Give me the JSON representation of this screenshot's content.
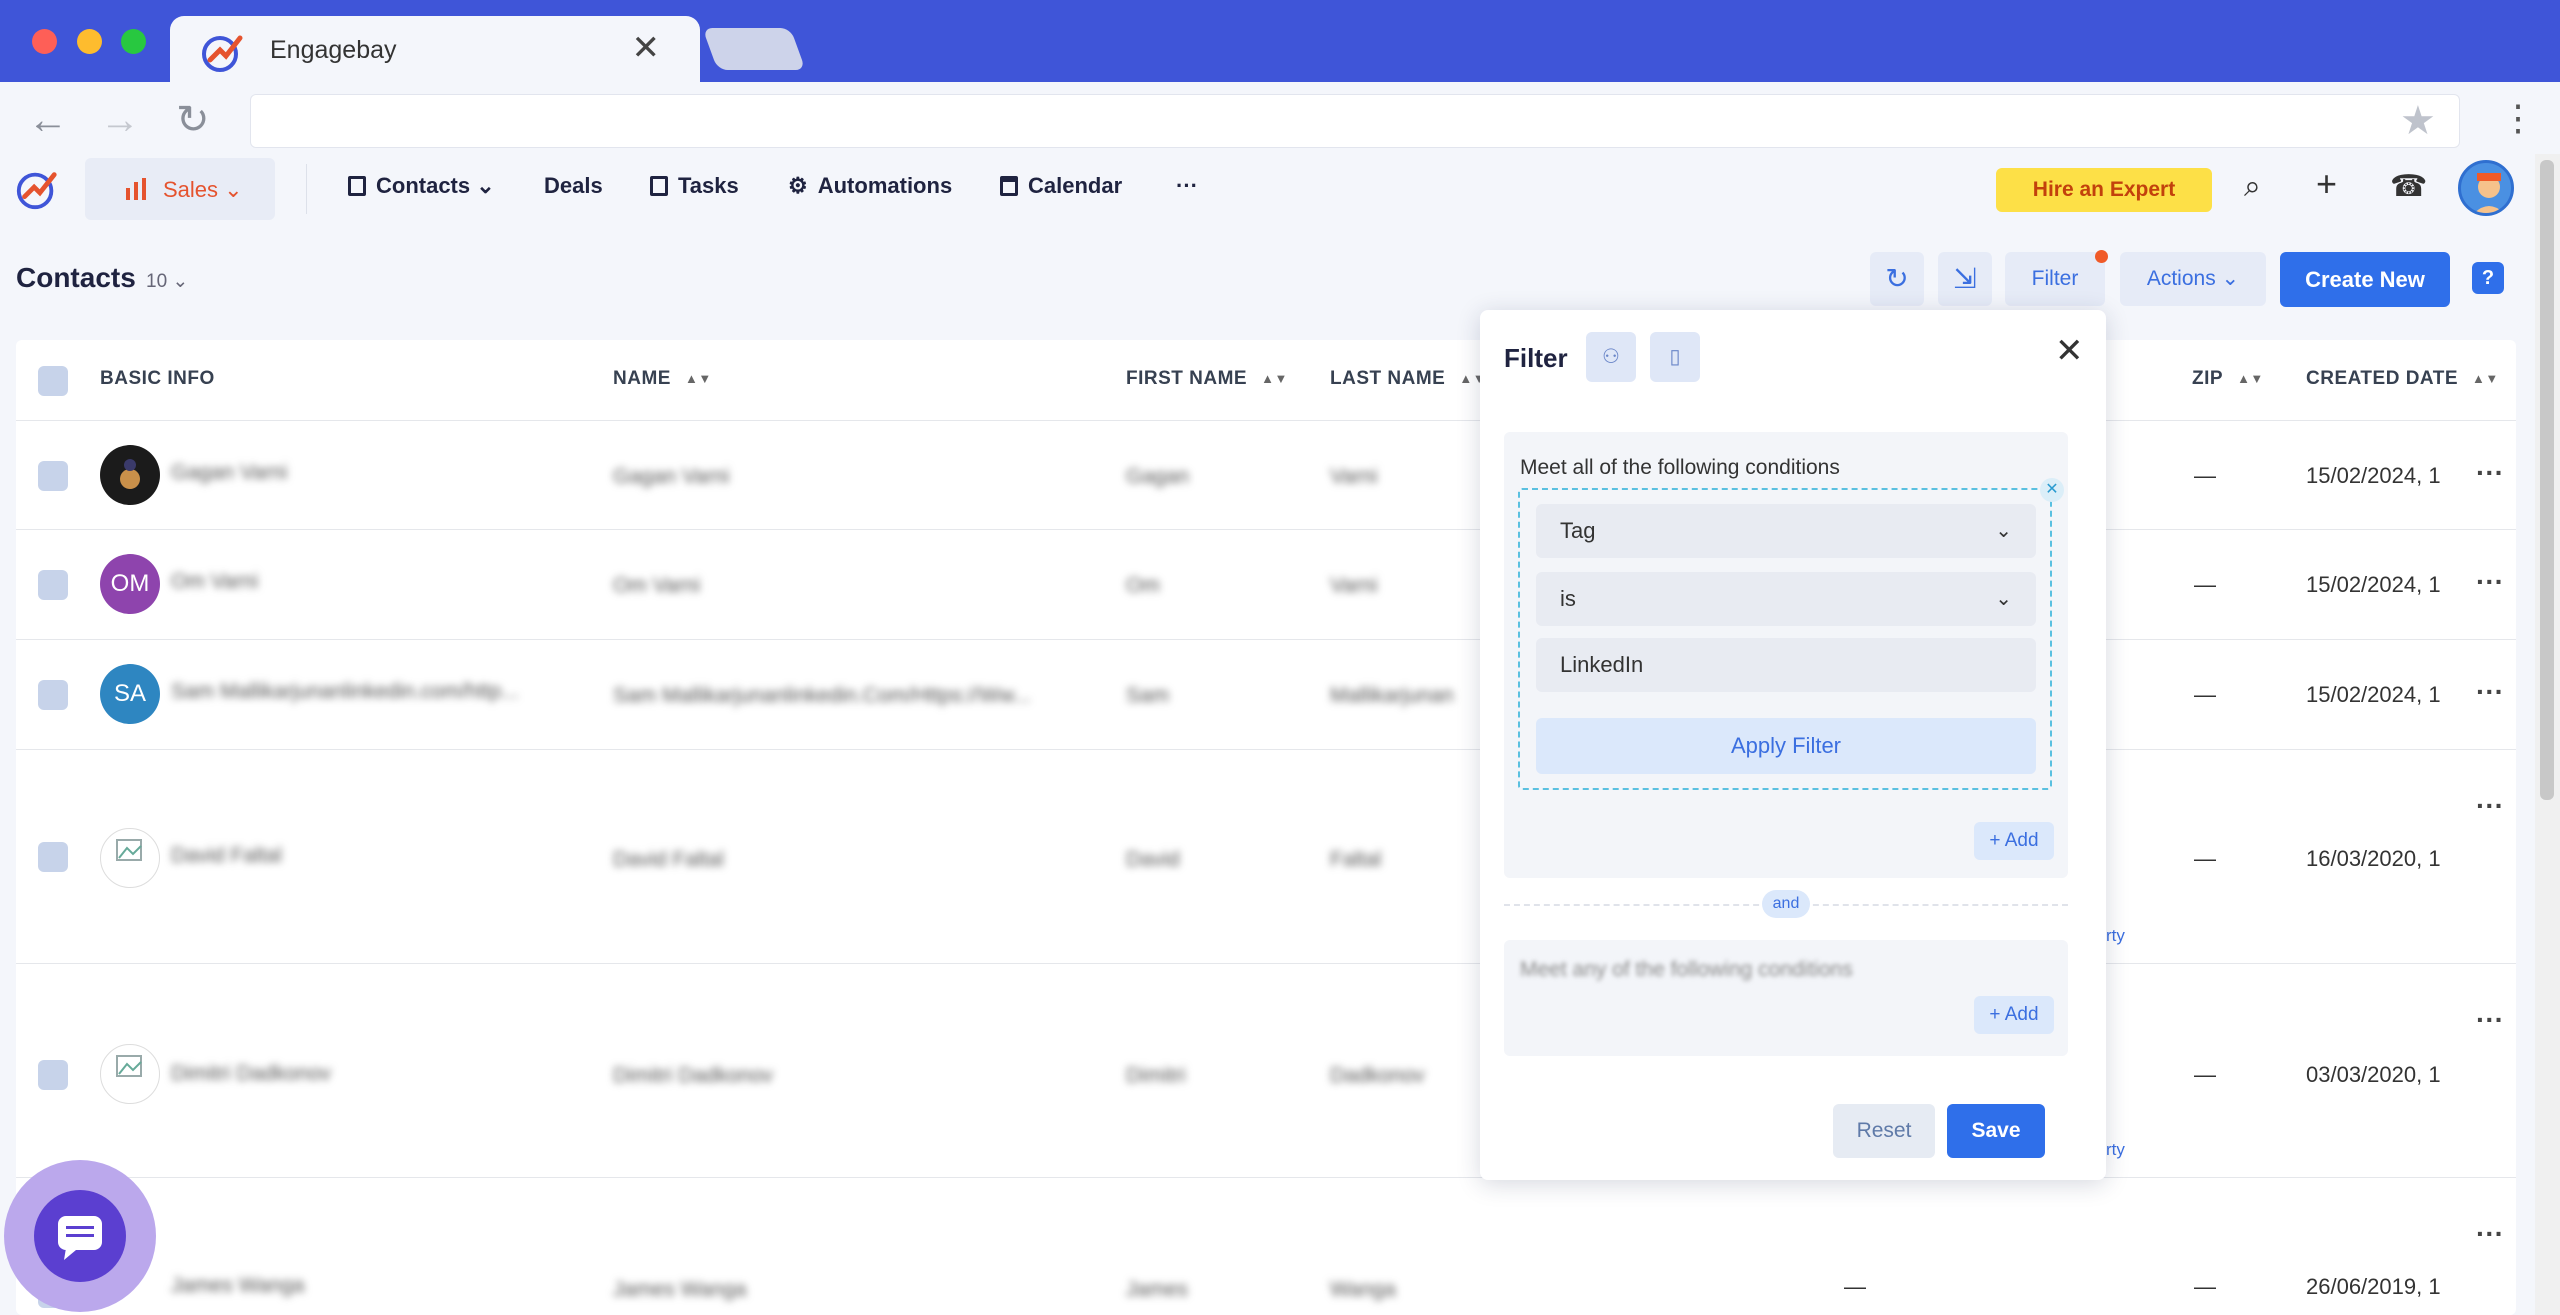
{
  "browser": {
    "tab_title": "Engagebay",
    "tab_close": "✕",
    "back": "←",
    "forward": "→",
    "reload": "↻",
    "star": "★",
    "menu": "⋮"
  },
  "appnav": {
    "sales_label": "Sales ⌄",
    "items": [
      {
        "label": "Contacts ⌄"
      },
      {
        "label": "Deals"
      },
      {
        "label": "Tasks"
      },
      {
        "label": "Automations"
      },
      {
        "label": "Calendar"
      },
      {
        "label": "···"
      }
    ],
    "hire_label": "Hire an Expert",
    "search": "⌕",
    "add": "+",
    "phone": "☎"
  },
  "page": {
    "title": "Contacts",
    "count": "10 ⌄",
    "refresh": "↻",
    "import": "⇲",
    "filter_label": "Filter",
    "actions_label": "Actions ⌄",
    "create_new_label": "Create New",
    "help": "?"
  },
  "table": {
    "headers": {
      "basic_info": "BASIC INFO",
      "name": "NAME",
      "first_name": "FIRST NAME",
      "last_name": "LAST NAME",
      "zip": "ZIP",
      "created_date": "CREATED DATE"
    },
    "sort_icon": "▲▼",
    "rows": [
      {
        "initials": "",
        "basic": "Gagan Varni",
        "name": "Gagan Varni",
        "first": "Gagan",
        "last": "Varni",
        "zip": "—",
        "created": "15/02/2024, 1"
      },
      {
        "initials": "OM",
        "basic": "Om Varni",
        "name": "Om Varni",
        "first": "Om",
        "last": "Varni",
        "zip": "—",
        "created": "15/02/2024, 1"
      },
      {
        "initials": "SA",
        "basic": "Sam Mallikarjunanlinkedin.com/http...",
        "name": "Sam Mallikarjunanlinkedin.Com/Https://Ww...",
        "first": "Sam",
        "last": "Mallikarjunan",
        "zip": "—",
        "created": "15/02/2024, 1"
      },
      {
        "initials": "",
        "basic": "David Faltal",
        "name": "David Faltal",
        "first": "David",
        "last": "Faltal",
        "zip": "—",
        "created": "16/03/2020, 1"
      },
      {
        "initials": "",
        "basic": "Dimitri Dadkonov",
        "name": "Dimitri Dadkonov",
        "first": "Dimitri",
        "last": "Dadkonov",
        "zip": "—",
        "created": "03/03/2020, 1"
      },
      {
        "initials": "",
        "basic": "James Wanga",
        "name": "James Wanga",
        "first": "James",
        "last": "Wanga",
        "zip": "—",
        "created": "26/06/2019, 1"
      }
    ],
    "row_menu": "···",
    "tag_fragments": [
      "rty",
      "rty"
    ]
  },
  "filter": {
    "title": "Filter",
    "close": "✕",
    "group_all_title": "Meet all of the following conditions",
    "condition": {
      "field": "Tag",
      "operator": "is",
      "value": "LinkedIn",
      "apply_label": "Apply Filter",
      "remove": "✕",
      "chevron": "⌄"
    },
    "add_label": "+ Add",
    "and_label": "and",
    "group_any_title": "Meet any of the following conditions",
    "reset_label": "Reset",
    "save_label": "Save"
  },
  "colors": {
    "brand_blue": "#2f6fea",
    "titlebar": "#3f55d8",
    "sales_orange": "#e5532e",
    "hire_yellow": "#fde047"
  }
}
